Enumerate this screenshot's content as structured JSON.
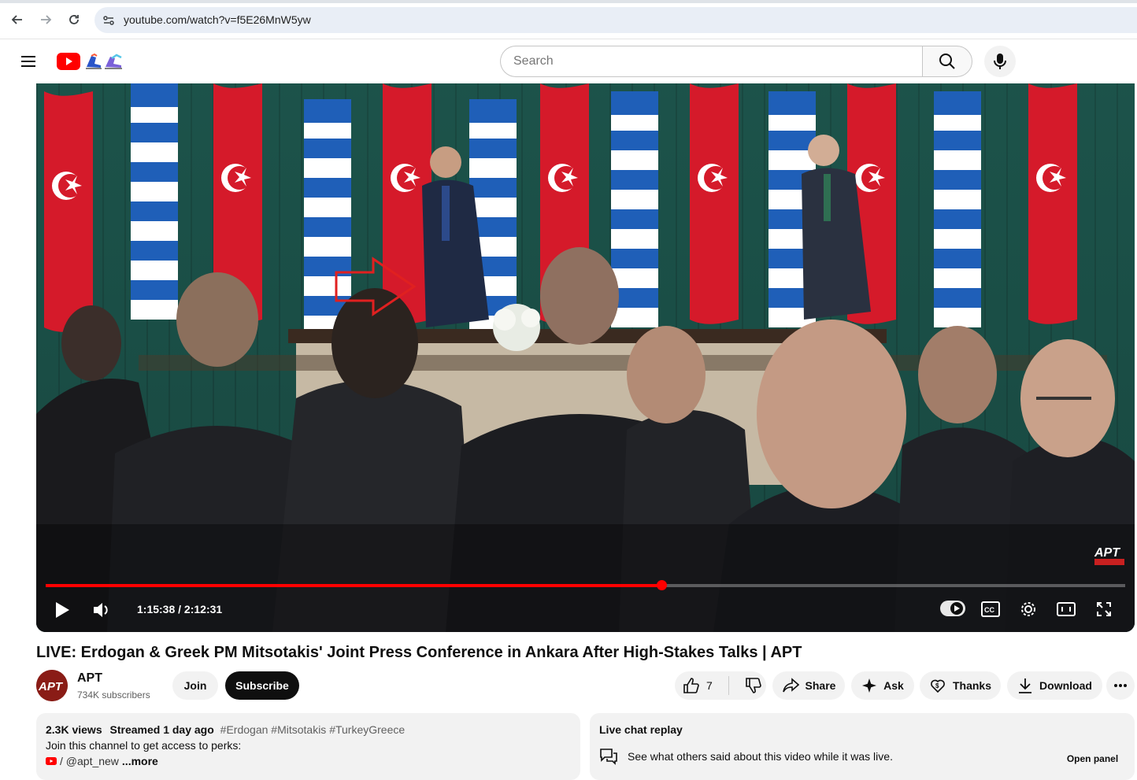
{
  "browser": {
    "url": "youtube.com/watch?v=f5E26MnW5yw"
  },
  "header": {
    "search_placeholder": "Search"
  },
  "player": {
    "time": "1:15:38 / 2:12:31",
    "progress": 0.5707,
    "watermark": "APT",
    "scene_icons": [
      "turkey-flag",
      "greece-flag"
    ]
  },
  "video": {
    "title": "LIVE: Erdogan & Greek PM Mitsotakis' Joint Press Conference in Ankara After High-Stakes Talks | APT"
  },
  "channel": {
    "name": "APT",
    "subscribers": "734K subscribers",
    "avatar_text": "APT",
    "join_label": "Join",
    "subscribe_label": "Subscribe"
  },
  "actions": {
    "like_count": "7",
    "share_label": "Share",
    "ask_label": "Ask",
    "thanks_label": "Thanks",
    "download_label": "Download"
  },
  "description": {
    "views": "2.3K views",
    "streamed": "Streamed 1 day ago",
    "hashtags": "#Erdogan #Mitsotakis #TurkeyGreece",
    "line2": "Join this channel to get access to perks:",
    "link_text": "/ @apt_new",
    "more_label": "...more"
  },
  "chat": {
    "title": "Live chat replay",
    "description": "See what others said about this video while it was live.",
    "open_label": "Open panel"
  },
  "colors": {
    "accent": "#ff0000",
    "annotation_arrow": "#e02020"
  }
}
